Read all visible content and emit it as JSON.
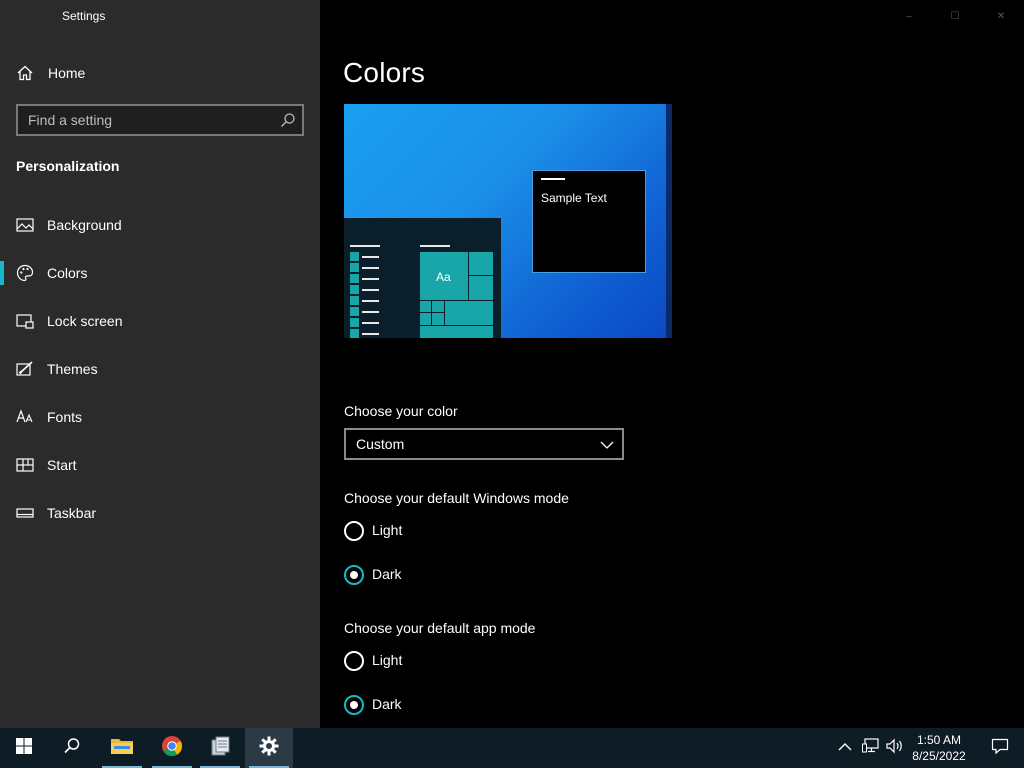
{
  "window": {
    "title": "Settings",
    "controls": {
      "minimize": "–",
      "maximize": "☐",
      "close": "✕"
    }
  },
  "sidebar": {
    "home_label": "Home",
    "search": {
      "placeholder": "Find a setting",
      "value": ""
    },
    "section_title": "Personalization",
    "items": [
      {
        "label": "Background",
        "icon": "picture-icon",
        "selected": false
      },
      {
        "label": "Colors",
        "icon": "palette-icon",
        "selected": true
      },
      {
        "label": "Lock screen",
        "icon": "lock-screen-icon",
        "selected": false
      },
      {
        "label": "Themes",
        "icon": "brush-icon",
        "selected": false
      },
      {
        "label": "Fonts",
        "icon": "fonts-icon",
        "selected": false
      },
      {
        "label": "Start",
        "icon": "start-icon",
        "selected": false
      },
      {
        "label": "Taskbar",
        "icon": "taskbar-icon",
        "selected": false
      }
    ]
  },
  "main": {
    "title": "Colors",
    "preview": {
      "sample_text": "Sample Text",
      "tile_text": "Aa"
    },
    "choose_color": {
      "label": "Choose your color",
      "value": "Custom"
    },
    "windows_mode": {
      "label": "Choose your default Windows mode",
      "options": [
        "Light",
        "Dark"
      ],
      "selected": "Dark"
    },
    "app_mode": {
      "label": "Choose your default app mode",
      "options": [
        "Light",
        "Dark"
      ],
      "selected": "Dark"
    }
  },
  "taskbar": {
    "apps": [
      "start-icon",
      "search-icon",
      "file-explorer-icon",
      "chrome-icon",
      "file-manager-icon",
      "settings-icon"
    ],
    "active_app": "settings-icon",
    "tray_icons": [
      "chevron-up-icon",
      "network-icon",
      "volume-icon"
    ],
    "time": "1:50 AM",
    "date": "8/25/2022"
  },
  "colors": {
    "accent": "#17b8c9",
    "sidebar_bg": "#2b2b2b",
    "main_bg": "#000000",
    "taskbar_bg": "#0e1c26"
  }
}
